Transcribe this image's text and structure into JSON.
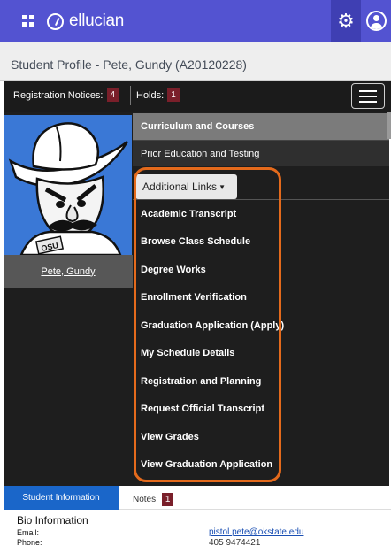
{
  "header": {
    "brand": "ellucian",
    "icons": [
      "apps-grid-icon",
      "settings-gear-icon",
      "user-profile-icon"
    ]
  },
  "page": {
    "title": "Student Profile - Pete, Gundy (A20120228)"
  },
  "notices": {
    "registration_label": "Registration Notices:",
    "registration_count": "4",
    "holds_label": "Holds:",
    "holds_count": "1"
  },
  "profile": {
    "name": "Pete, Gundy"
  },
  "menu": {
    "curriculum": "Curriculum and Courses",
    "prior": "Prior Education and Testing",
    "additional_links": "Additional Links",
    "links": [
      "Academic Transcript",
      "Browse Class Schedule",
      "Degree Works",
      "Enrollment Verification",
      "Graduation Application (Apply)",
      "My Schedule Details",
      "Registration and Planning",
      "Request Official Transcript",
      "View Grades",
      "View Graduation Application"
    ]
  },
  "tabs": {
    "student_information": "Student Information",
    "notes_label": "Notes:",
    "notes_count": "1"
  },
  "bio": {
    "title": "Bio Information",
    "email_label": "Email:",
    "email_value": "pistol.pete@okstate.edu",
    "phone_label": "Phone:",
    "phone_value": "405 9474421"
  },
  "colors": {
    "topbar": "#5353d1",
    "highlight": "#e46a1c",
    "badge": "#7a1f2a",
    "tab_active": "#1a66c9"
  }
}
